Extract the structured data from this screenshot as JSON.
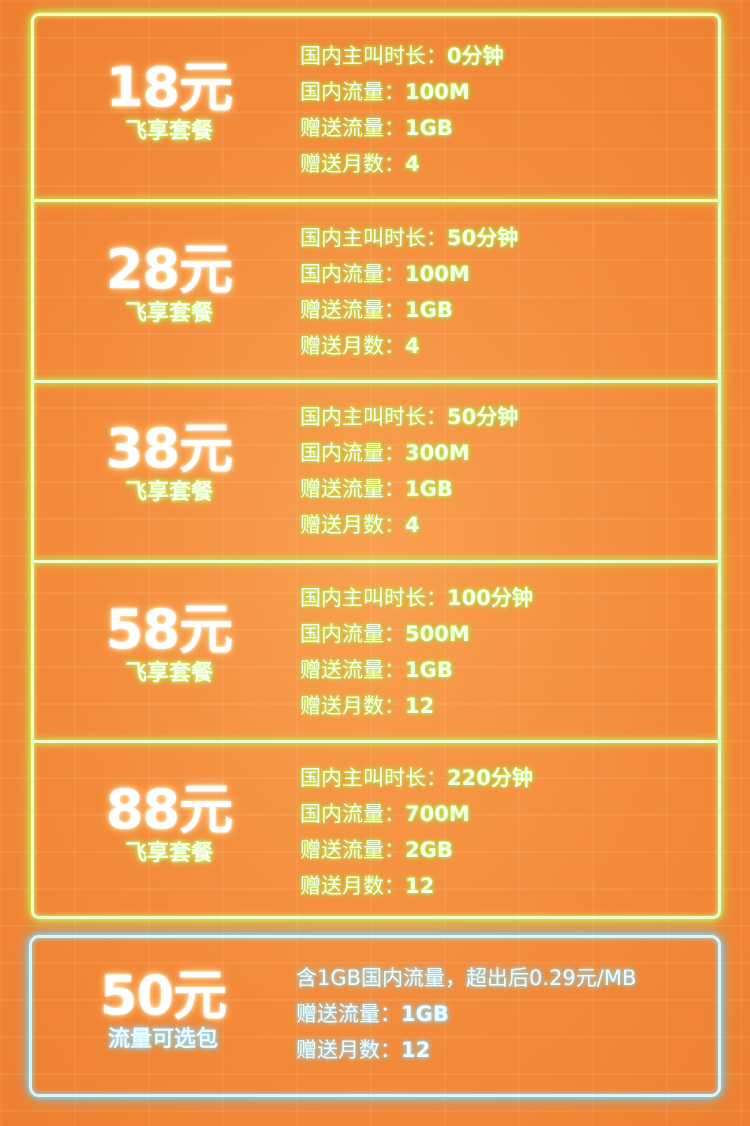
{
  "plans": [
    {
      "price": "18元",
      "name": "飞享套餐",
      "lines": [
        {
          "k": "国内主叫时长：",
          "v": "0分钟"
        },
        {
          "k": "国内流量：",
          "v": "100M"
        },
        {
          "k": "赠送流量：",
          "v": "1GB"
        },
        {
          "k": "赠送月数：",
          "v": "4"
        }
      ]
    },
    {
      "price": "28元",
      "name": "飞享套餐",
      "lines": [
        {
          "k": "国内主叫时长：",
          "v": "50分钟"
        },
        {
          "k": "国内流量：",
          "v": "100M"
        },
        {
          "k": "赠送流量：",
          "v": "1GB"
        },
        {
          "k": "赠送月数：",
          "v": "4"
        }
      ]
    },
    {
      "price": "38元",
      "name": "飞享套餐",
      "lines": [
        {
          "k": "国内主叫时长：",
          "v": "50分钟"
        },
        {
          "k": "国内流量：",
          "v": "300M"
        },
        {
          "k": "赠送流量：",
          "v": "1GB"
        },
        {
          "k": "赠送月数：",
          "v": "4"
        }
      ]
    },
    {
      "price": "58元",
      "name": "飞享套餐",
      "lines": [
        {
          "k": "国内主叫时长：",
          "v": "100分钟"
        },
        {
          "k": "国内流量：",
          "v": "500M"
        },
        {
          "k": "赠送流量：",
          "v": "1GB"
        },
        {
          "k": "赠送月数：",
          "v": "12"
        }
      ]
    },
    {
      "price": "88元",
      "name": "飞享套餐",
      "lines": [
        {
          "k": "国内主叫时长：",
          "v": "220分钟"
        },
        {
          "k": "国内流量：",
          "v": "700M"
        },
        {
          "k": "赠送流量：",
          "v": "2GB"
        },
        {
          "k": "赠送月数：",
          "v": "12"
        }
      ]
    }
  ],
  "data_pack": {
    "price": "50元",
    "name": "流量可选包",
    "desc": "含1GB国内流量，超出后0.29元/MB",
    "lines": [
      {
        "k": "赠送流量：",
        "v": "1GB"
      },
      {
        "k": "赠送月数：",
        "v": "12"
      }
    ]
  },
  "colors": {
    "background": "#f6893a",
    "green_glow": "#d4ff7a",
    "blue_glow": "#8be6ff"
  }
}
